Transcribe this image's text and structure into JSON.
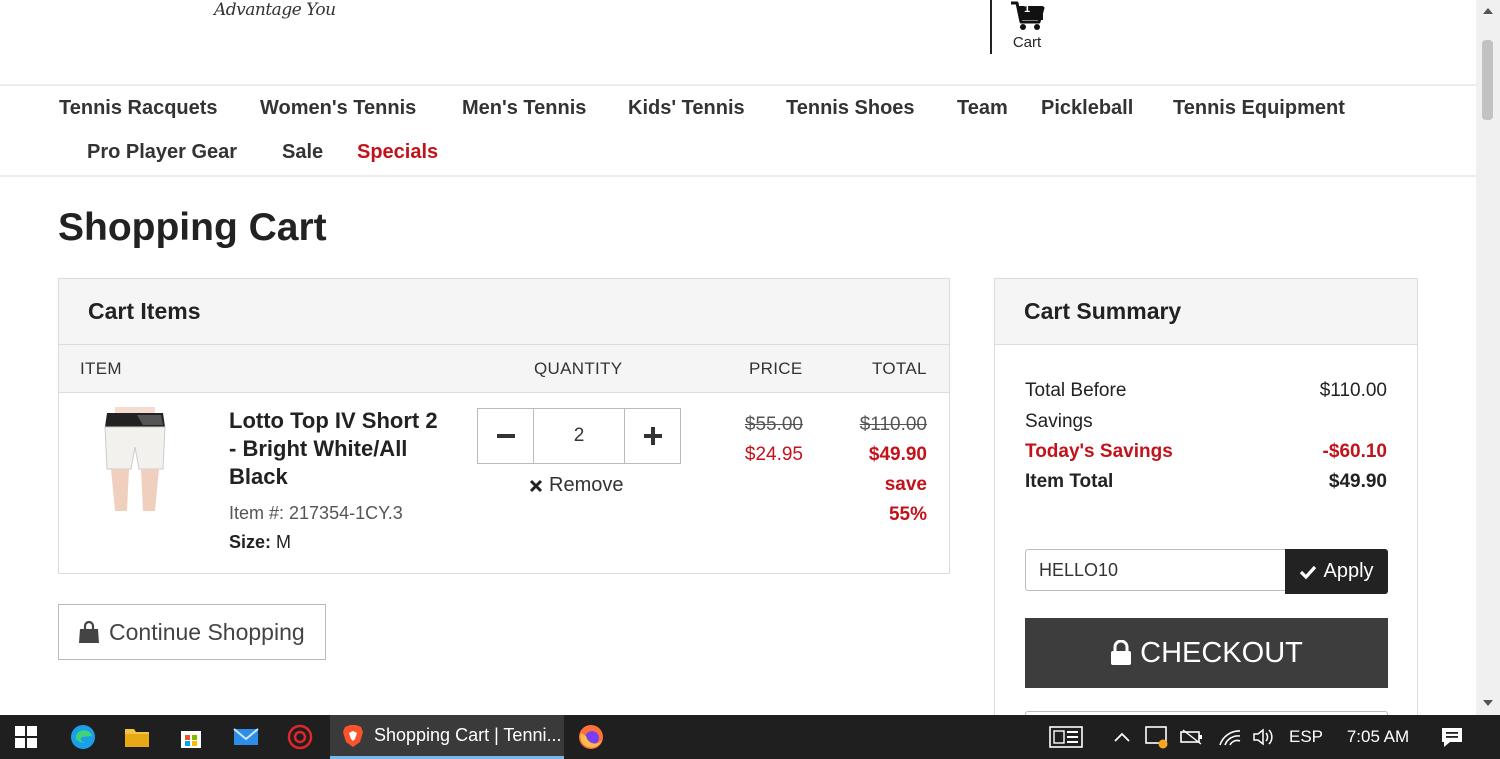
{
  "header": {
    "logo_tagline": "Advantage You",
    "cart_count": "1",
    "cart_label": "Cart"
  },
  "nav": {
    "items": [
      "Tennis Racquets",
      "Women's Tennis",
      "Men's Tennis",
      "Kids' Tennis",
      "Tennis Shoes",
      "Team",
      "Pickleball",
      "Tennis Equipment",
      "Pro Player Gear",
      "Sale",
      "Specials"
    ]
  },
  "page_title": "Shopping Cart",
  "cart_items": {
    "heading": "Cart Items",
    "columns": {
      "item": "ITEM",
      "quantity": "QUANTITY",
      "price": "PRICE",
      "total": "TOTAL"
    },
    "item": {
      "name": "Lotto Top IV Short 2 - Bright White/All Black",
      "sku": "Item #: 217354-1CY.3",
      "size_label": "Size:",
      "size_value": "M",
      "quantity": "2",
      "remove_label": "Remove",
      "price_original": "$55.00",
      "price_sale": "$24.95",
      "total_original": "$110.00",
      "total_sale": "$49.90",
      "save_word": "save",
      "save_pct": "55%"
    }
  },
  "continue_label": "Continue Shopping",
  "summary": {
    "heading": "Cart Summary",
    "total_before_label_1": "Total Before",
    "total_before_label_2": "Savings",
    "total_before_value": "$110.00",
    "savings_label": "Today's Savings",
    "savings_value": "-$60.10",
    "item_total_label": "Item Total",
    "item_total_value": "$49.90",
    "promo_code": "HELLO10",
    "apply_label": "Apply",
    "checkout_label": "CHECKOUT"
  },
  "taskbar": {
    "active_window": "Shopping Cart | Tenni...",
    "language": "ESP",
    "time": "7:05 AM"
  },
  "colors": {
    "accent_red": "#c4121a",
    "checkout_bg": "#3d3d3d",
    "apply_bg": "#222222",
    "taskbar_bg": "#1f1f1f"
  }
}
